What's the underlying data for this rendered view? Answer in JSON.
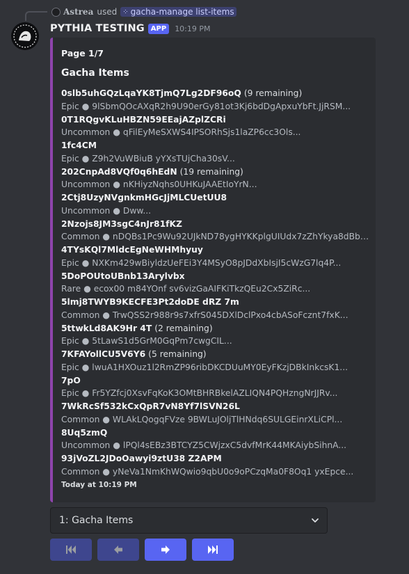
{
  "reply": {
    "username": "Astrea",
    "action": "used",
    "command": "gacha-manage list-items"
  },
  "message": {
    "username": "PYTHIA TESTING",
    "badge": "APP",
    "timestamp": "10:19 PM"
  },
  "embed": {
    "accent_color": "#8e44ad",
    "page_label": "Page 1/7",
    "title": "Gacha Items",
    "items": [
      {
        "name": "0slb5uhGQzLqaYK8TjmQ7Lg2DF96oQ",
        "remaining": "(9 remaining)",
        "desc": "Epic ● 9lSbmQOcAXqR2h9U90erGy81ot3Kj6bdDgApxuYbFt.JjRSM..."
      },
      {
        "name": "0T1RQgvKLuHBZN59EEajAZplZCRi",
        "remaining": "",
        "desc": "Uncommon ● qFilEyMeSXWS4IPSORhSjs1laZP6cc3Ols..."
      },
      {
        "name": "1fc4CM",
        "remaining": "",
        "desc": "Epic ● Z9h2VuWBiuB yYXsTUjCha30sV..."
      },
      {
        "name": "202CnpAd8VQf0q6hEdN",
        "remaining": "(19 remaining)",
        "desc": "Uncommon ● nKHiyzNqhs0UHKuJAAEtIoYrN..."
      },
      {
        "name": "2Ctj8UzyNVgnkmHGcJjMLCUetUU8",
        "remaining": "",
        "desc": "Uncommon ● Dww..."
      },
      {
        "name": "2Nzojs8JM3sgC4nJr81fKZ",
        "remaining": "",
        "desc": "Common ● nDQBs1Pc9Wu92UJkND78ygHYKKplgUIUdx7zZhYkya8dBbW..."
      },
      {
        "name": "4TYsKQl7MldcEgNeWHMhyuy",
        "remaining": "",
        "desc": "Epic ● NXKm429wBiyldzUeFEi3Y4MSyO8pJDdXbIsjI5cWzG7lq4P..."
      },
      {
        "name": "5DoPOUtoUBnb13Arylvbx",
        "remaining": "",
        "desc": "Rare ● ecox00 m84YOnf sv6vizGaAIFKiTkzQEu2Cx5ZiRc..."
      },
      {
        "name": "5lmj8TWYB9KECFE3Pt2doDE dRZ 7m",
        "remaining": "",
        "desc": "Common ● TrwQSS2r988r9s7xfrS045DXlDclPxo4cbASoFcznt7fxK..."
      },
      {
        "name": "5ttwkLd8AK9Hr 4T",
        "remaining": "(2 remaining)",
        "desc": "Epic ● 5tLawS1d5GrM0GqPm7cwgCIL..."
      },
      {
        "name": "7KFAYollCU5V6Y6",
        "remaining": "(5 remaining)",
        "desc": "Epic ● lwuA1HXOuz1l2RmZP96ribDKCDUuMY0EyFKzjDBkInkcsK1..."
      },
      {
        "name": "7pO",
        "remaining": "",
        "desc": "Epic ● Fr5YZfcj0XsvFqKoK3OMtBHRBkelAZLIQN4PQHzngNrJJRv..."
      },
      {
        "name": "7WkRcSf532kCxQpR7vN8Yf7lSVN26L",
        "remaining": "",
        "desc": "Common ● WLAkLQogqFVze 9BWLuJOljTlHNdq6SULGEinrXLiCPl..."
      },
      {
        "name": "8Uq5zmQ",
        "remaining": "",
        "desc": "Uncommon ● lPQl4sEBz3BTCYZ5CWjzxC5dvfMrK44MKAiybSihnA..."
      },
      {
        "name": "93jVoZL2JDoOawyi9ztU38 Z2APM",
        "remaining": "",
        "desc": "Common ● yNeVa1NmKhWQwio9qbU0o9oPCzqMa0F8Oq1 yxEpce..."
      }
    ],
    "footer": "Today at 10:19 PM"
  },
  "select": {
    "value": "1: Gacha Items"
  },
  "buttons": [
    {
      "name": "first-page",
      "icon": "first-page-icon",
      "state": "disabled"
    },
    {
      "name": "previous-page",
      "icon": "previous-page-icon",
      "state": "disabled"
    },
    {
      "name": "next-page",
      "icon": "next-page-icon",
      "state": "enabled"
    },
    {
      "name": "last-page",
      "icon": "last-page-icon",
      "state": "enabled"
    }
  ],
  "colors": {
    "background": "#313338",
    "embed_background": "#2b2d31",
    "blurple": "#5865f2",
    "button_icon": "#dbdee1"
  }
}
